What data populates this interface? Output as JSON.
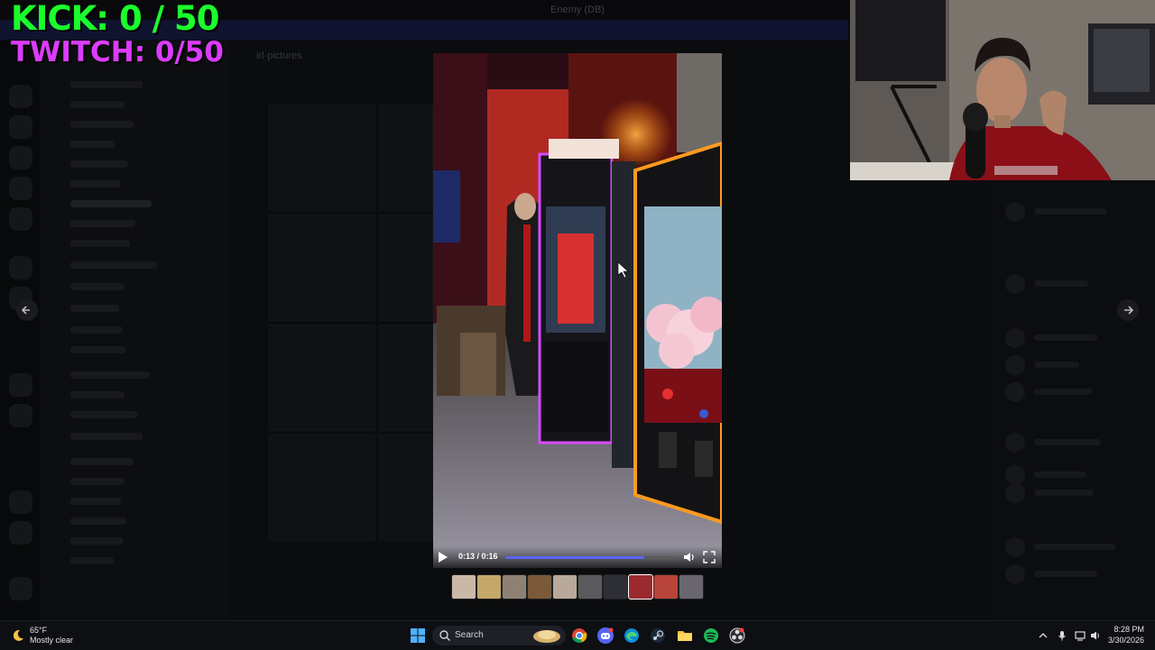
{
  "overlay": {
    "kick_counter": "KICK: 0 / 50",
    "twitch_counter": "TWITCH: 0/50"
  },
  "discord": {
    "window_title": "Enemy (DB)",
    "channel_name": "irl-pictures"
  },
  "video": {
    "time_display": "0:13 / 0:16",
    "progress_fraction": 0.8125,
    "accent_color": "#5865f2"
  },
  "taskbar": {
    "weather_temp": "65°F",
    "weather_desc": "Mostly clear",
    "search_label": "Search",
    "clock_time": "8:28 PM",
    "clock_date": "3/30/2026",
    "pinned_apps": [
      "windows-start-icon",
      "search-icon",
      "chrome-icon",
      "discord-icon",
      "edge-icon",
      "steam-icon",
      "file-explorer-icon",
      "spotify-icon",
      "obs-icon"
    ]
  }
}
